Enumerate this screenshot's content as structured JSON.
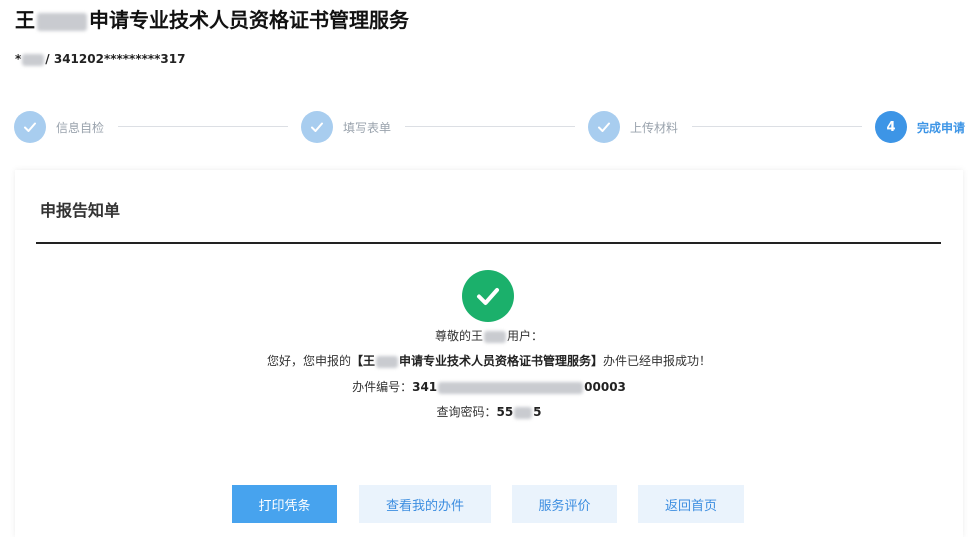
{
  "header": {
    "title_prefix": "王",
    "title_suffix": "申请专业技术人员资格证书管理服务",
    "id_prefix": "*",
    "id_suffix": "/ 341202*********317"
  },
  "steps": [
    {
      "label": "信息自检",
      "state": "done"
    },
    {
      "label": "填写表单",
      "state": "done"
    },
    {
      "label": "上传材料",
      "state": "done"
    },
    {
      "label": "完成申请",
      "state": "active",
      "number": "4"
    }
  ],
  "card": {
    "title": "申报告知单",
    "greeting_prefix": "尊敬的王",
    "greeting_suffix": "用户：",
    "notice_prefix": "您好，您申报的",
    "notice_item_prefix": "【王",
    "notice_item_suffix": "申请专业技术人员资格证书管理服务】",
    "notice_suffix": "办件已经申报成功！",
    "case_no_label": "办件编号：",
    "case_no_prefix": "341",
    "case_no_suffix": "00003",
    "password_label": "查询密码：",
    "password_prefix": "55",
    "password_suffix": "5"
  },
  "buttons": {
    "print": "打印凭条",
    "my_cases": "查看我的办件",
    "evaluate": "服务评价",
    "home": "返回首页"
  },
  "colors": {
    "primary": "#47a3ee",
    "step_done": "#a8cdef",
    "step_active": "#3d95e6",
    "success": "#1bb06b"
  }
}
